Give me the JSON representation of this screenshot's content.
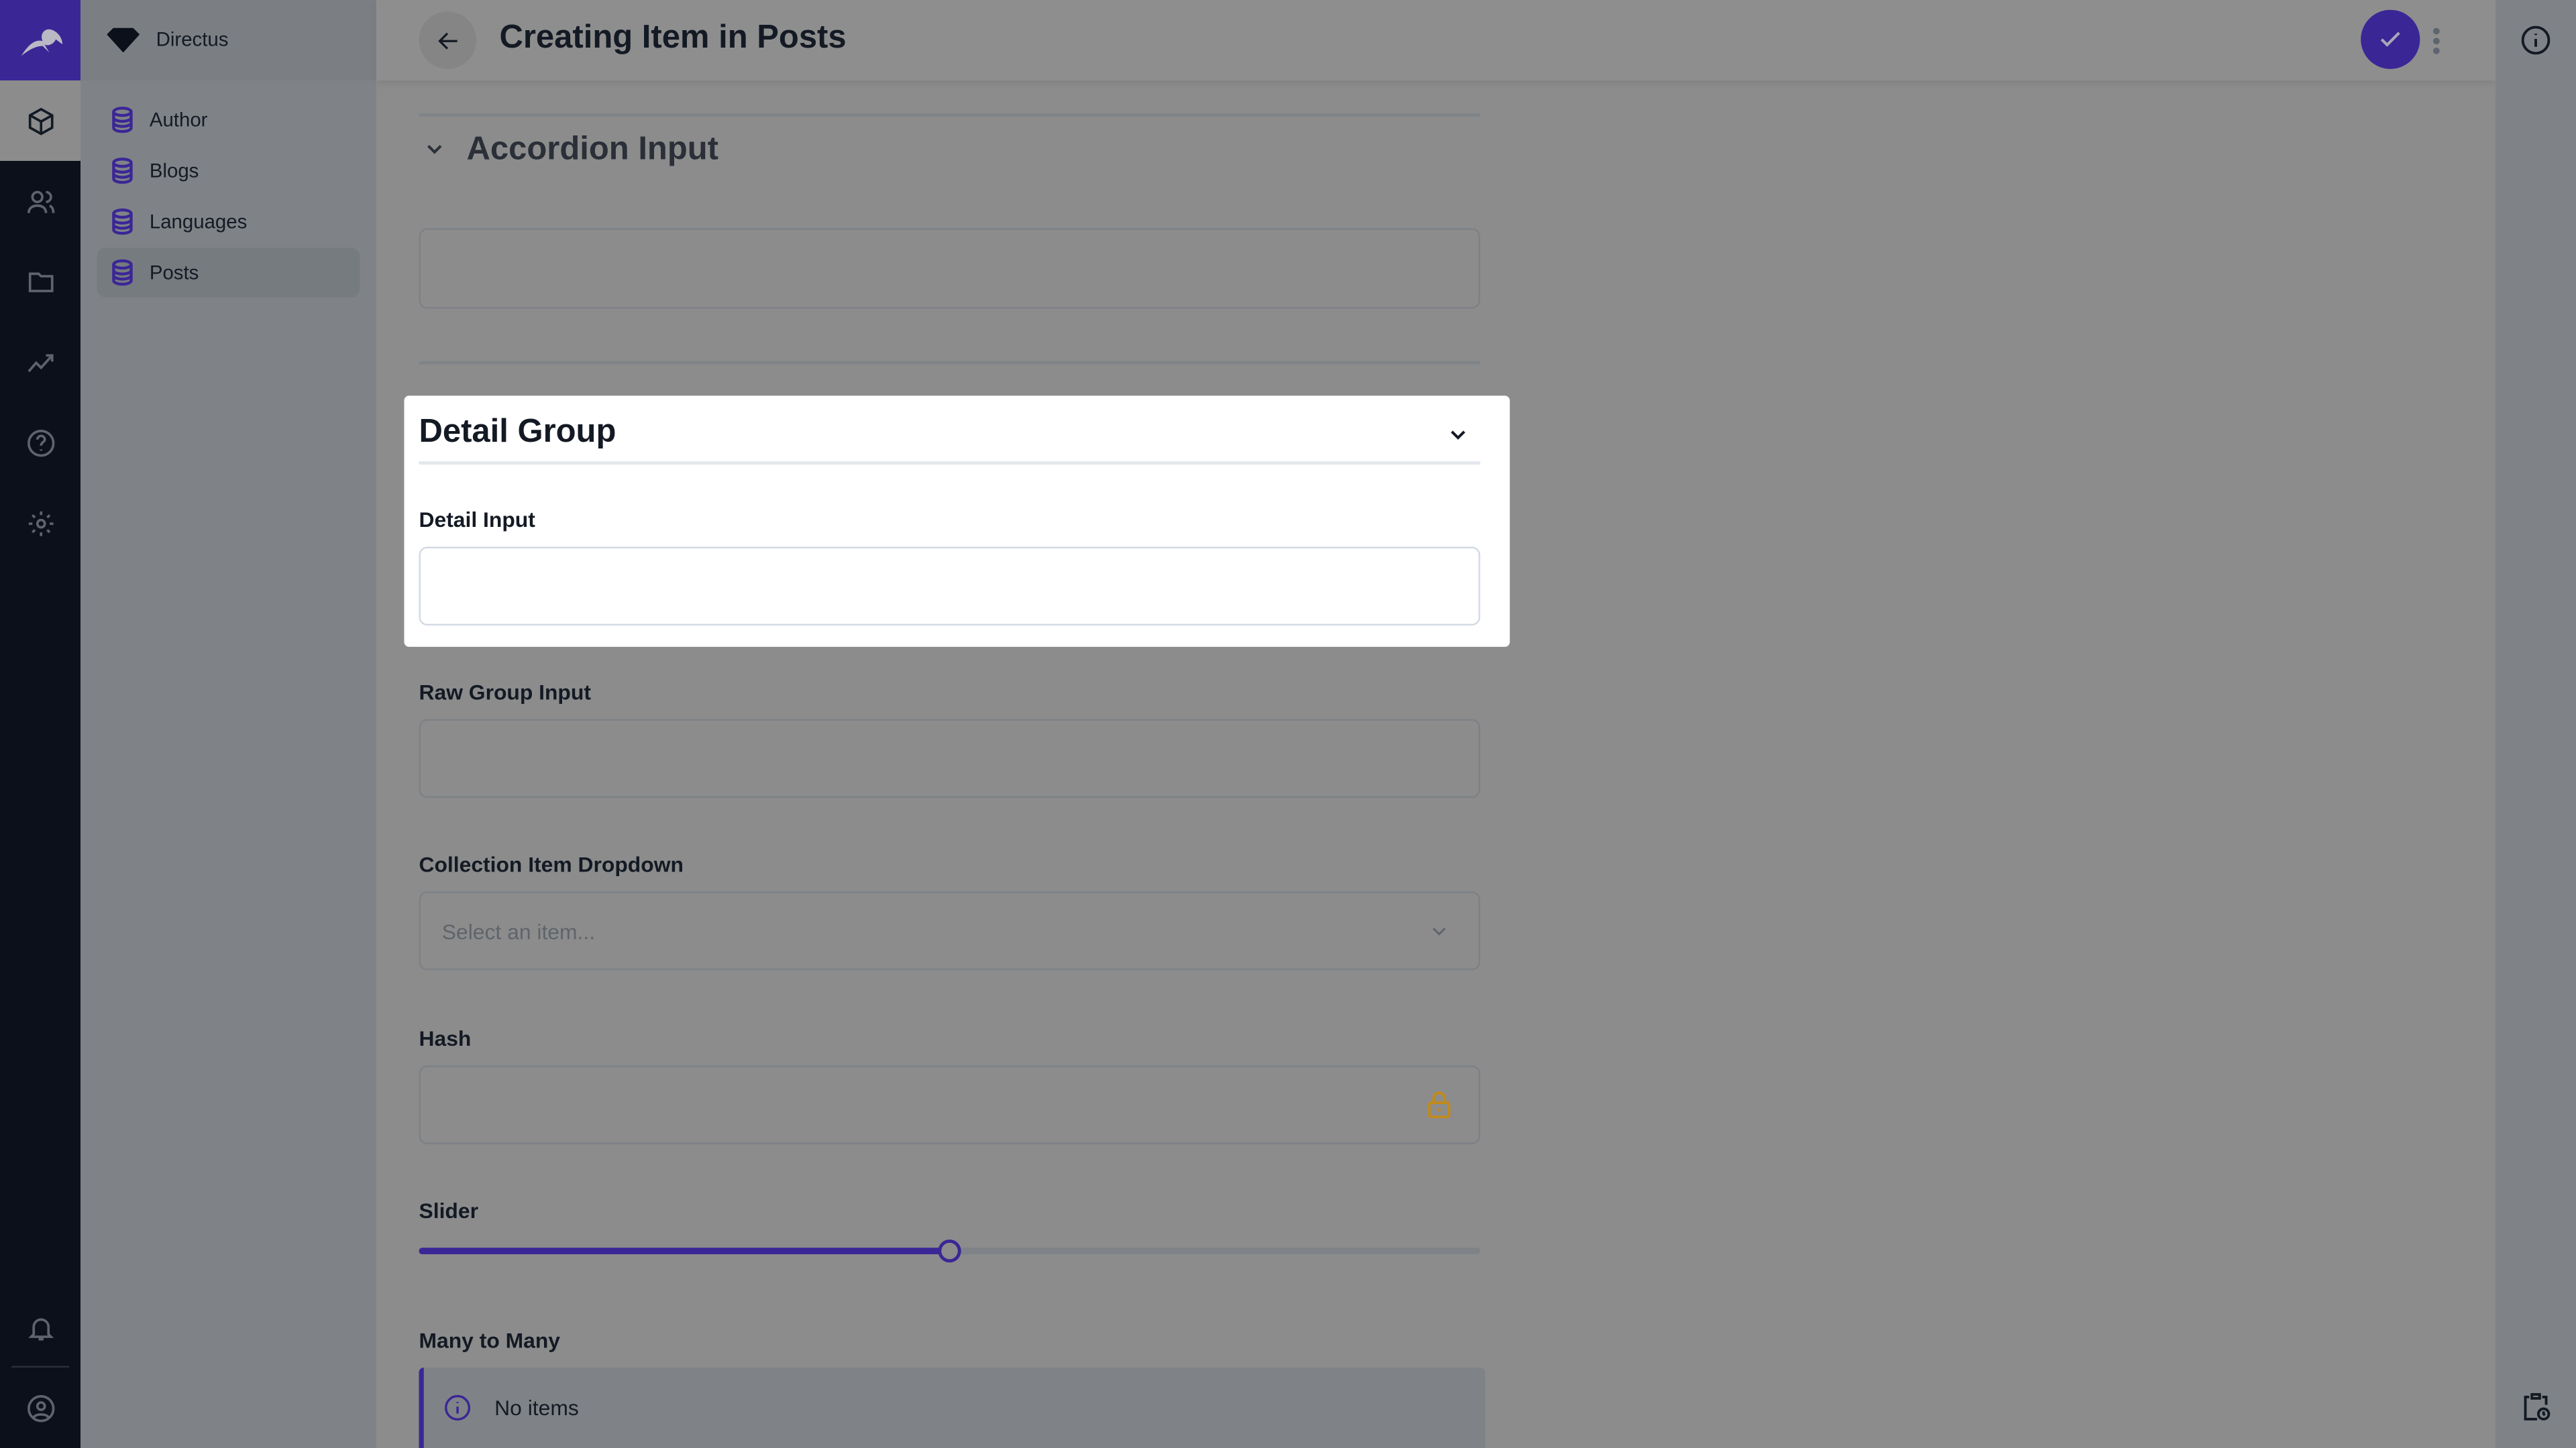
{
  "nav": {
    "project": "Directus",
    "collections": [
      {
        "label": "Author"
      },
      {
        "label": "Blogs"
      },
      {
        "label": "Languages"
      },
      {
        "label": "Posts",
        "active": true
      }
    ]
  },
  "header": {
    "title": "Creating Item in Posts"
  },
  "form": {
    "accordion_title": "Accordion Input",
    "detail_group_title": "Detail Group",
    "detail_input_label": "Detail Input",
    "raw_group_label": "Raw Group Input",
    "dropdown_label": "Collection Item Dropdown",
    "dropdown_placeholder": "Select an item...",
    "hash_label": "Hash",
    "slider_label": "Slider",
    "slider_value_fraction": 0.5,
    "m2m_label": "Many to Many",
    "m2m_empty": "No items"
  },
  "colors": {
    "accent": "#6644ff",
    "rail": "#0b101a",
    "lock": "#c08a1e"
  }
}
